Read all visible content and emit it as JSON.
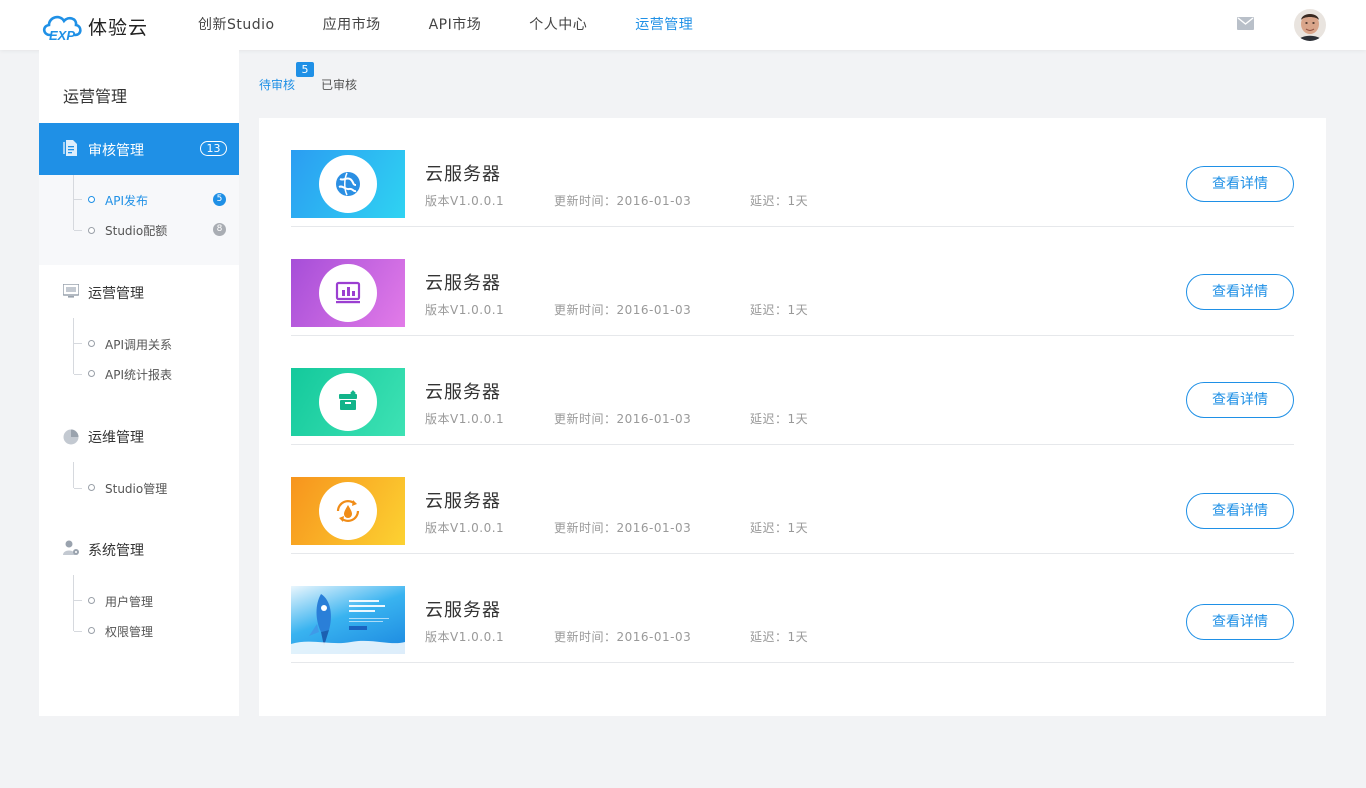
{
  "header": {
    "brand": "体验云",
    "nav": [
      "创新Studio",
      "应用市场",
      "API市场",
      "个人中心",
      "运营管理"
    ],
    "active_nav": 4
  },
  "sidebar": {
    "title": "运营管理",
    "groups": [
      {
        "label": "审核管理",
        "icon": "document-icon",
        "count": "13",
        "items": [
          {
            "label": "API发布",
            "badge": "5"
          },
          {
            "label": "Studio配额",
            "badge": "8"
          }
        ]
      },
      {
        "label": "运营管理",
        "icon": "monitor-icon",
        "items": [
          {
            "label": "API调用关系"
          },
          {
            "label": "API统计报表"
          }
        ]
      },
      {
        "label": "运维管理",
        "icon": "pie-chart-icon",
        "items": [
          {
            "label": "Studio管理"
          }
        ]
      },
      {
        "label": "系统管理",
        "icon": "user-settings-icon",
        "items": [
          {
            "label": "用户管理"
          },
          {
            "label": "权限管理"
          }
        ]
      }
    ]
  },
  "tabs": {
    "pending": "待审核",
    "pending_count": "5",
    "reviewed": "已审核"
  },
  "colors": {
    "accent": "#1f90e6",
    "thumb_blue": "#2eaae8",
    "thumb_purple": "#b25ddb",
    "thumb_green": "#1fd4a4",
    "thumb_orange": "#f9b21a"
  },
  "items": [
    {
      "title": "云服务器",
      "version": "版本V1.0.0.1",
      "updated": "更新时间：2016-01-03",
      "delay": "延迟：1天",
      "action": "查看详情",
      "thumb_icon": "globe-icon"
    },
    {
      "title": "云服务器",
      "version": "版本V1.0.0.1",
      "updated": "更新时间：2016-01-03",
      "delay": "延迟：1天",
      "action": "查看详情",
      "thumb_icon": "chart-screen-icon"
    },
    {
      "title": "云服务器",
      "version": "版本V1.0.0.1",
      "updated": "更新时间：2016-01-03",
      "delay": "延迟：1天",
      "action": "查看详情",
      "thumb_icon": "archive-box-icon"
    },
    {
      "title": "云服务器",
      "version": "版本V1.0.0.1",
      "updated": "更新时间：2016-01-03",
      "delay": "延迟：1天",
      "action": "查看详情",
      "thumb_icon": "drop-refresh-icon"
    },
    {
      "title": "云服务器",
      "version": "版本V1.0.0.1",
      "updated": "更新时间：2016-01-03",
      "delay": "延迟：1天",
      "action": "查看详情",
      "thumb_icon": "rocket-banner-image"
    }
  ]
}
